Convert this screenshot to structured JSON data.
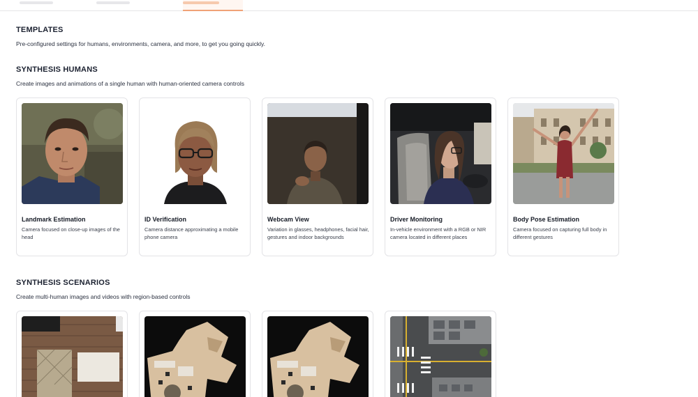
{
  "templates": {
    "title": "TEMPLATES",
    "description": "Pre-configured settings for humans, environments, camera, and more, to get you going quickly."
  },
  "synthesis_humans": {
    "title": "SYNTHESIS HUMANS",
    "description": "Create images and animations of a single human with human-oriented camera controls",
    "cards": [
      {
        "title": "Landmark Estimation",
        "description": "Camera focused on close-up images of the head"
      },
      {
        "title": "ID Verification",
        "description": "Camera distance approximating a mobile phone camera"
      },
      {
        "title": "Webcam View",
        "description": "Variation in glasses, headphones, facial hair, gestures and indoor backgrounds"
      },
      {
        "title": "Driver Monitoring",
        "description": "In-vehicle environment with a RGB or NIR camera located in different places"
      },
      {
        "title": "Body Pose Estimation",
        "description": "Camera focused on capturing full body in different gestures"
      }
    ]
  },
  "synthesis_scenarios": {
    "title": "SYNTHESIS SCENARIOS",
    "description": "Create multi-human images and videos with region-based controls"
  },
  "icons": {
    "thumb_1": "head-closeup-image",
    "thumb_2": "id-portrait-image",
    "thumb_3": "webcam-person-image",
    "thumb_4": "driver-in-car-image",
    "thumb_5": "full-body-pose-image",
    "scenario_1": "room-floorplan-image",
    "scenario_2": "building-topdown-image",
    "scenario_3": "building-topdown-image",
    "scenario_4": "street-intersection-image"
  },
  "colors": {
    "active_tab_accent": "#f0a277",
    "card_border": "#e3e3e6"
  }
}
